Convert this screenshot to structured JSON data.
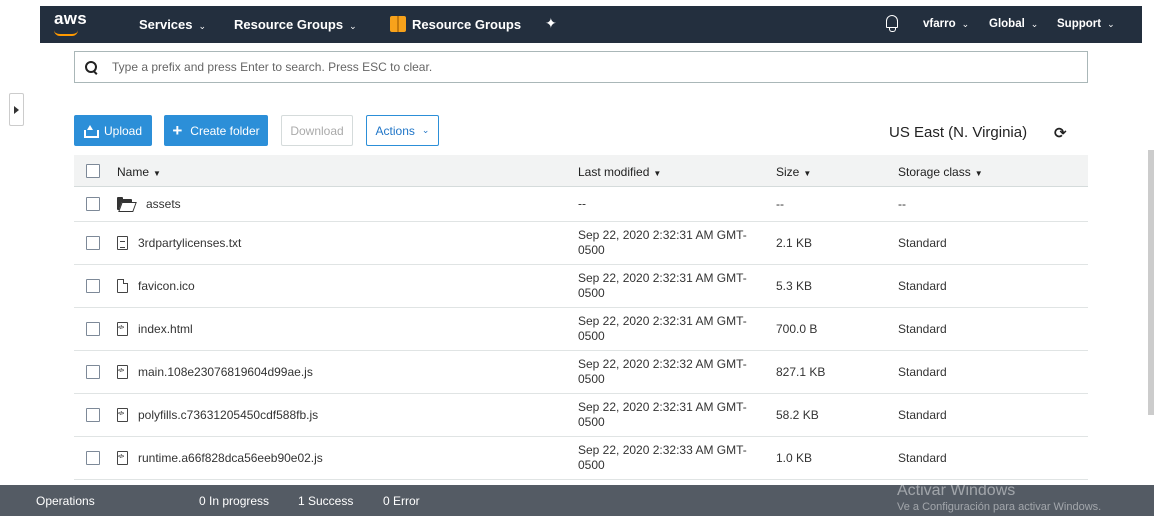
{
  "nav": {
    "logo": "aws",
    "services": "Services",
    "resource_groups_menu": "Resource Groups",
    "resource_groups_link": "Resource Groups",
    "user": "vfarro",
    "region": "Global",
    "support": "Support",
    "chevron": "⌄"
  },
  "search": {
    "placeholder": "Type a prefix and press Enter to search. Press ESC to clear."
  },
  "toolbar": {
    "upload": "Upload",
    "create_folder": "Create folder",
    "download": "Download",
    "actions": "Actions",
    "region": "US East (N. Virginia)"
  },
  "table": {
    "headers": {
      "name": "Name",
      "last_modified": "Last modified",
      "size": "Size",
      "storage_class": "Storage class"
    },
    "rows": [
      {
        "name": "assets",
        "type": "folder-icon",
        "modified": "--",
        "size": "--",
        "class": "--"
      },
      {
        "name": "3rdpartylicenses.txt",
        "type": "text-file-icon",
        "modified": "Sep 22, 2020 2:32:31 AM GMT-0500",
        "size": "2.1 KB",
        "class": "Standard"
      },
      {
        "name": "favicon.ico",
        "type": "file-icon",
        "modified": "Sep 22, 2020 2:32:31 AM GMT-0500",
        "size": "5.3 KB",
        "class": "Standard"
      },
      {
        "name": "index.html",
        "type": "code-file-icon",
        "modified": "Sep 22, 2020 2:32:31 AM GMT-0500",
        "size": "700.0 B",
        "class": "Standard"
      },
      {
        "name": "main.108e23076819604d99ae.js",
        "type": "code-file-icon",
        "modified": "Sep 22, 2020 2:32:32 AM GMT-0500",
        "size": "827.1 KB",
        "class": "Standard"
      },
      {
        "name": "polyfills.c73631205450cdf588fb.js",
        "type": "code-file-icon",
        "modified": "Sep 22, 2020 2:32:31 AM GMT-0500",
        "size": "58.2 KB",
        "class": "Standard"
      },
      {
        "name": "runtime.a66f828dca56eeb90e02.js",
        "type": "code-file-icon",
        "modified": "Sep 22, 2020 2:32:33 AM GMT-0500",
        "size": "1.0 KB",
        "class": "Standard"
      }
    ]
  },
  "operations": {
    "label": "Operations",
    "in_progress": "0 In progress",
    "success": "1 Success",
    "error": "0 Error"
  },
  "watermark": {
    "title": "Activar Windows",
    "subtitle": "Ve a Configuración para activar Windows."
  },
  "colors": {
    "nav_bg": "#232f3e",
    "primary": "#2c8fd8",
    "opbar_bg": "#545b64",
    "brand_orange": "#ff9900"
  }
}
